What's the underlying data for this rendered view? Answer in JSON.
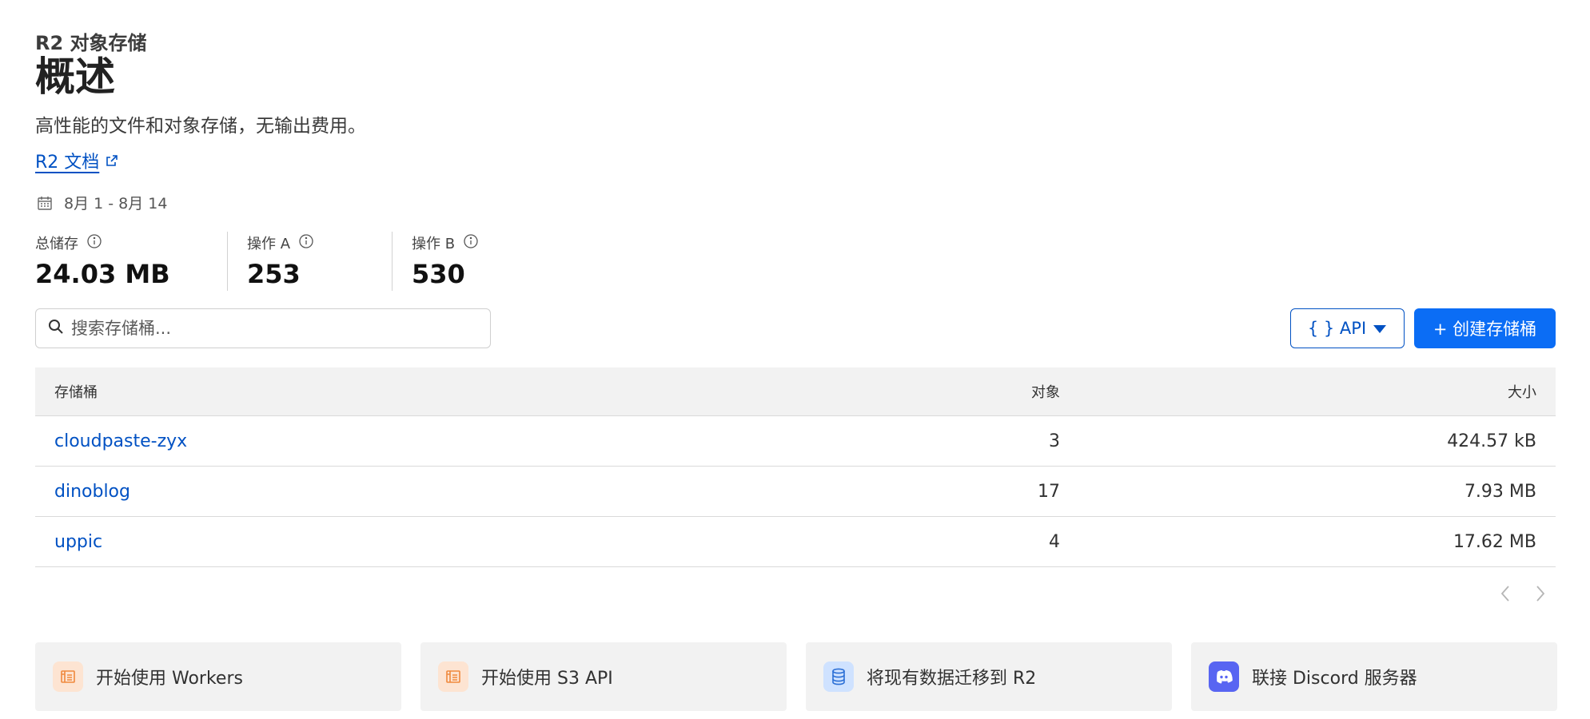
{
  "header": {
    "subtitle": "R2 对象存储",
    "title": "概述",
    "description": "高性能的文件和对象存储，无输出费用。",
    "docs_link": "R2 文档"
  },
  "date_range": "8月 1 - 8月 14",
  "metrics": [
    {
      "label": "总储存",
      "value": "24.03 MB"
    },
    {
      "label": "操作 A",
      "value": "253"
    },
    {
      "label": "操作 B",
      "value": "530"
    }
  ],
  "search": {
    "placeholder": "搜索存储桶..."
  },
  "buttons": {
    "api": "{ } API",
    "create": "+ 创建存储桶"
  },
  "table": {
    "headers": {
      "name": "存储桶",
      "objects": "对象",
      "size": "大小"
    },
    "rows": [
      {
        "name": "cloudpaste-zyx",
        "objects": "3",
        "size": "424.57 kB"
      },
      {
        "name": "dinoblog",
        "objects": "17",
        "size": "7.93 MB"
      },
      {
        "name": "uppic",
        "objects": "4",
        "size": "17.62 MB"
      }
    ]
  },
  "cards": [
    {
      "label": "开始使用 Workers",
      "icon": "document-icon"
    },
    {
      "label": "开始使用 S3 API",
      "icon": "document-icon"
    },
    {
      "label": "将现有数据迁移到 R2",
      "icon": "database-icon"
    },
    {
      "label": "联接 Discord 服务器",
      "icon": "discord-icon"
    }
  ],
  "colors": {
    "accent": "#0051c3",
    "primary_button": "#0b6df5",
    "discord": "#5865f2"
  }
}
